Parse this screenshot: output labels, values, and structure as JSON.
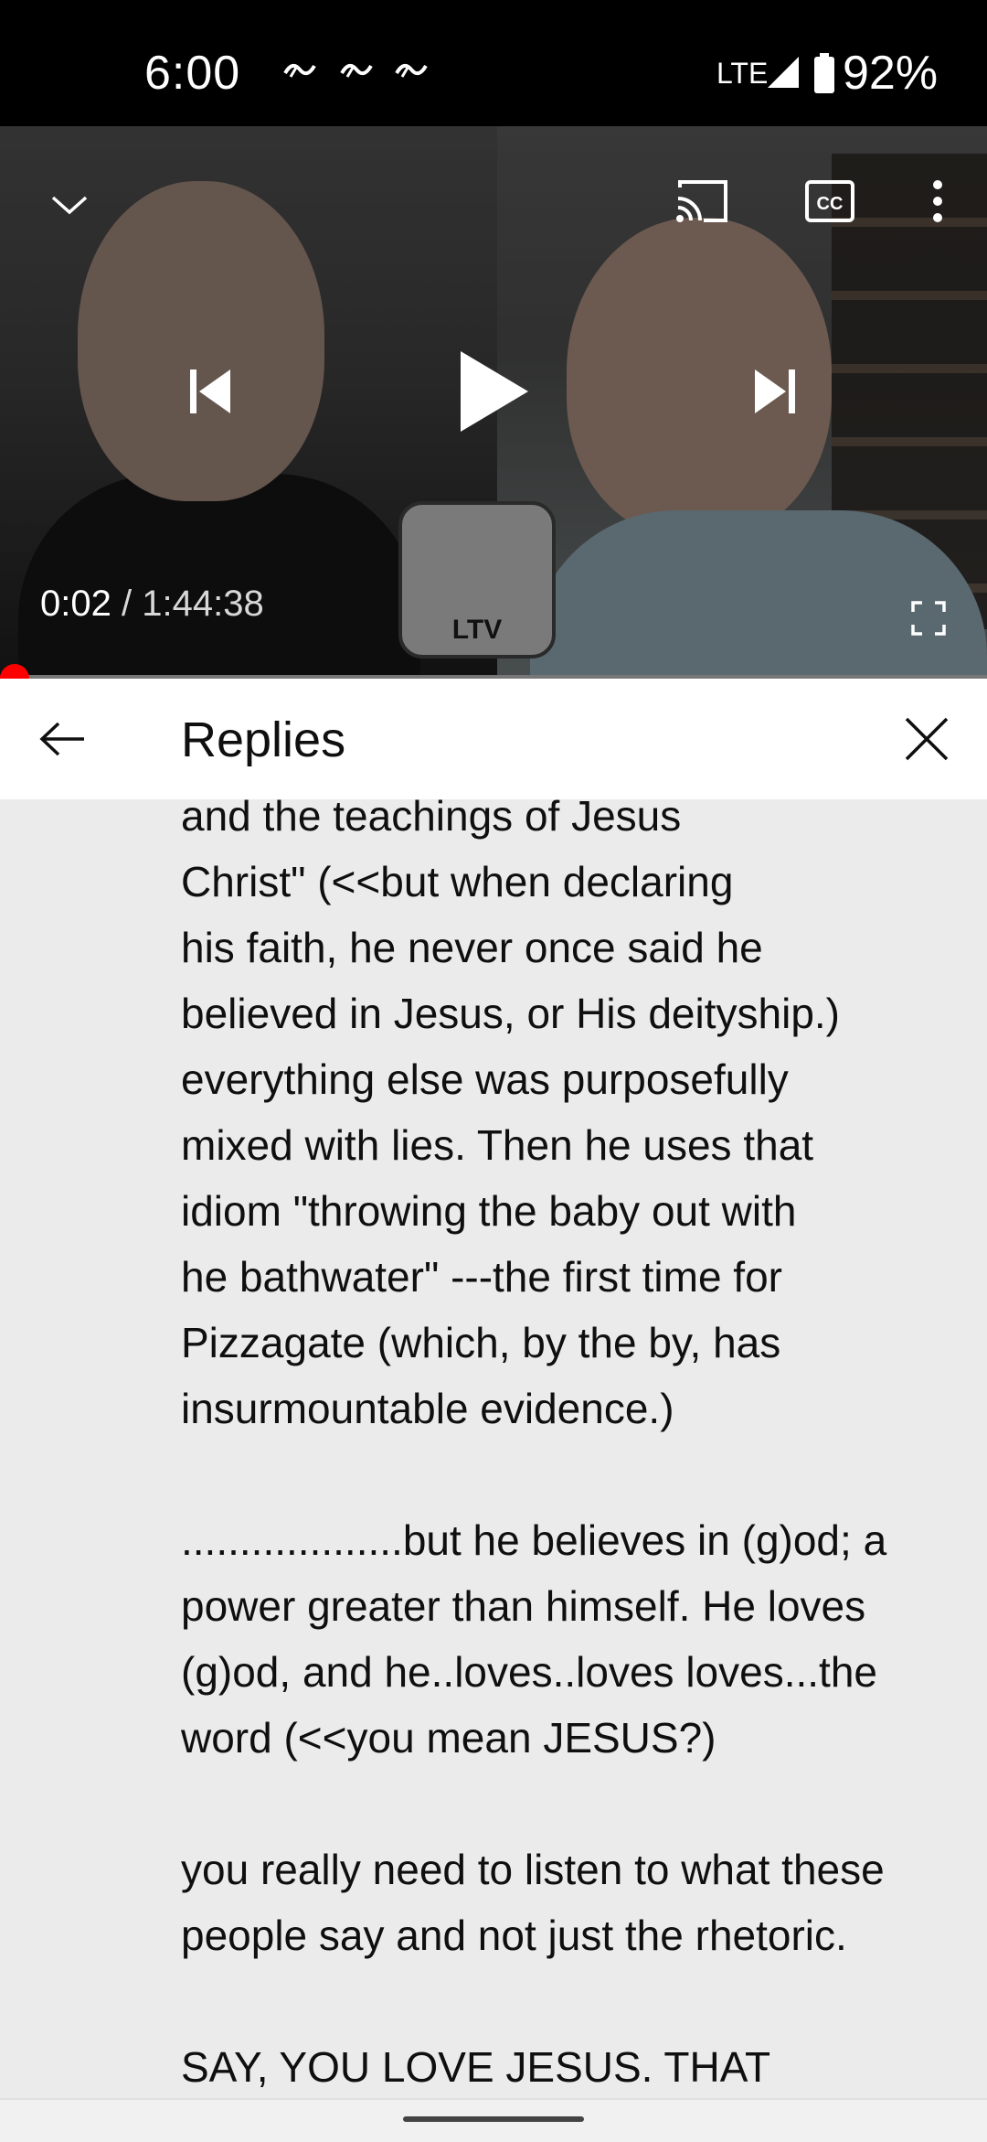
{
  "status_bar": {
    "time": "6:00",
    "notification_icons": [
      "notification-icon",
      "notification-icon",
      "notification-icon"
    ],
    "network": "LTE",
    "battery_percent": "92%"
  },
  "player": {
    "current_time": "0:02",
    "separator": "/",
    "duration": "1:44:38",
    "progress_fraction": 0.0003,
    "logo_text": "LTV",
    "accent_color": "#ff0000"
  },
  "replies": {
    "title": "Replies",
    "comment_text": "and the teachings of Jesus\nChrist\" (<<but when declaring\nhis faith, he never once said he\nbelieved in Jesus, or His deityship.)\neverything else was purposefully\nmixed with lies. Then he uses that\nidiom \"throwing the baby out with\nhe bathwater\" ---the first time for\nPizzagate (which, by the by, has\ninsurmountable evidence.)\n\n...................but he believes in (g)od; a\npower greater than himself. He loves\n(g)od, and he..loves..loves loves...the\nword (<<you mean JESUS?)\n\nyou really need to listen to what these\npeople say and not just the rhetoric.\n\nSAY, YOU LOVE JESUS. THAT"
  }
}
